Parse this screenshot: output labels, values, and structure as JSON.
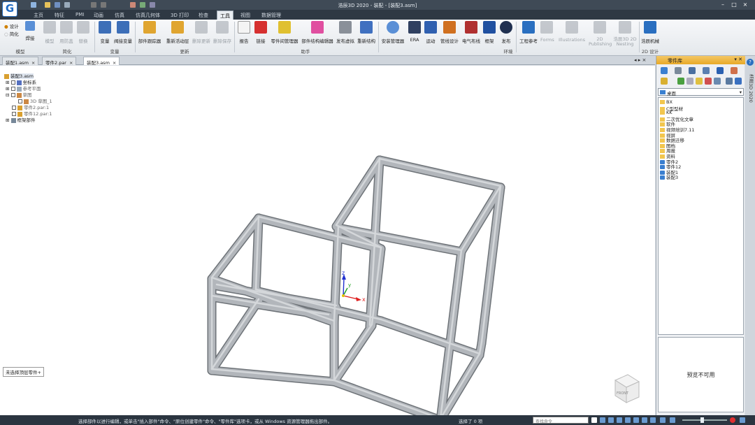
{
  "app": {
    "logo": "G",
    "title": "浩辰3D 2020 - 装配 - [装配3.asm]"
  },
  "window_controls": [
    "–",
    "□",
    "×"
  ],
  "menu_tabs": [
    {
      "label": "主页",
      "active": false
    },
    {
      "label": "特征",
      "active": false
    },
    {
      "label": "PMI",
      "active": false
    },
    {
      "label": "动画",
      "active": false
    },
    {
      "label": "仿真",
      "active": false
    },
    {
      "label": "仿真几何体",
      "active": false
    },
    {
      "label": "3D 打印",
      "active": false
    },
    {
      "label": "检查",
      "active": false
    },
    {
      "label": "工具",
      "active": true
    },
    {
      "label": "视图",
      "active": false
    },
    {
      "label": "数据管理",
      "active": false
    }
  ],
  "ribbon": {
    "model_small": [
      "设计",
      "简化"
    ],
    "buttons": [
      {
        "label": "焊接",
        "enabled": true
      },
      {
        "label": "模型",
        "enabled": false
      },
      {
        "label": "用防盖",
        "enabled": false
      },
      {
        "label": "替换",
        "enabled": false
      },
      {
        "label": "变量",
        "enabled": true
      },
      {
        "label": "阀接变量",
        "enabled": true
      },
      {
        "label": "部件跟踪器",
        "enabled": true
      },
      {
        "label": "重新活动层",
        "enabled": true
      },
      {
        "label": "删除更新",
        "enabled": false
      },
      {
        "label": "删除保存",
        "enabled": false
      },
      {
        "label": "报告",
        "enabled": true
      },
      {
        "label": "链接",
        "enabled": true
      },
      {
        "label": "零件间管理器",
        "enabled": true
      },
      {
        "label": "部件结构编辑器",
        "enabled": true
      },
      {
        "label": "发布虚拟",
        "enabled": true
      },
      {
        "label": "重新结构",
        "enabled": true
      },
      {
        "label": "安装管理器",
        "enabled": true
      },
      {
        "label": "ERA",
        "enabled": true
      },
      {
        "label": "运动",
        "enabled": true
      },
      {
        "label": "管线设计",
        "enabled": true
      },
      {
        "label": "电气布线",
        "enabled": true
      },
      {
        "label": "框架",
        "enabled": true
      },
      {
        "label": "发布",
        "enabled": true
      },
      {
        "label": "工程参考",
        "enabled": true
      },
      {
        "label": "Forms",
        "enabled": false
      },
      {
        "label": "Illustrations",
        "enabled": false
      },
      {
        "label": "2D Publishing",
        "enabled": false
      },
      {
        "label": "浩辰3D 2D Nesting",
        "enabled": false
      },
      {
        "label": "浩辰机械",
        "enabled": true
      }
    ],
    "groups": [
      "模型",
      "简化",
      "变量",
      "更新",
      "助手",
      "环境",
      "2D 设计"
    ]
  },
  "doc_tabs": [
    {
      "label": "装配1.asm",
      "active": false
    },
    {
      "label": "零件2.par",
      "active": false
    },
    {
      "label": "装配3.asm",
      "active": true
    }
  ],
  "tree": [
    {
      "label": "装配3.asm",
      "indent": 0
    },
    {
      "label": "坐标系",
      "indent": 1
    },
    {
      "label": "参考平面",
      "indent": 1
    },
    {
      "label": "草图",
      "indent": 1
    },
    {
      "label": "3D 草图_1",
      "indent": 2
    },
    {
      "label": "零件2.par:1",
      "indent": 1
    },
    {
      "label": "零件12.par:1",
      "indent": 1
    },
    {
      "label": "框架部件",
      "indent": 0
    }
  ],
  "viewport": {
    "hint": "未选择顶层零件+",
    "axes": {
      "x": "x",
      "y": "y",
      "z": "z"
    },
    "view_cube": "FRONT"
  },
  "part_library": {
    "title": "零件库",
    "location": "桌面",
    "items": [
      {
        "label": "BX",
        "kind": "folder"
      },
      {
        "label": "C型型材",
        "kind": "folder"
      },
      {
        "label": "KK",
        "kind": "folder"
      },
      {
        "label": "二次优化文章",
        "kind": "folder"
      },
      {
        "label": "软件",
        "kind": "folder"
      },
      {
        "label": "视频培训7.11",
        "kind": "folder"
      },
      {
        "label": "视屏",
        "kind": "folder"
      },
      {
        "label": "数据迁移",
        "kind": "folder"
      },
      {
        "label": "图档",
        "kind": "folder"
      },
      {
        "label": "周报",
        "kind": "folder"
      },
      {
        "label": "资料",
        "kind": "folder"
      },
      {
        "label": "零件2",
        "kind": "assembly"
      },
      {
        "label": "零件12",
        "kind": "assembly"
      },
      {
        "label": "装配1",
        "kind": "assembly"
      },
      {
        "label": "装配3",
        "kind": "assembly"
      }
    ],
    "preview": "预览不可用"
  },
  "side_strip": "浩辰3D 2020",
  "status": {
    "message": "选择部件以进行编辑，或单击\"插入部件\"命令、\"原位创建零件\"命令、\"零件库\"选项卡，或从 Windows 资源管理器拖出部件。",
    "selection": "选择了 0 项",
    "search_placeholder": "查找命令"
  },
  "colors": {
    "frame_tube": "#b2b6bb",
    "ribbon_accent": "#e8a927",
    "axis_x": "#e02020",
    "axis_y": "#1fa01f",
    "axis_z": "#2030d0"
  }
}
